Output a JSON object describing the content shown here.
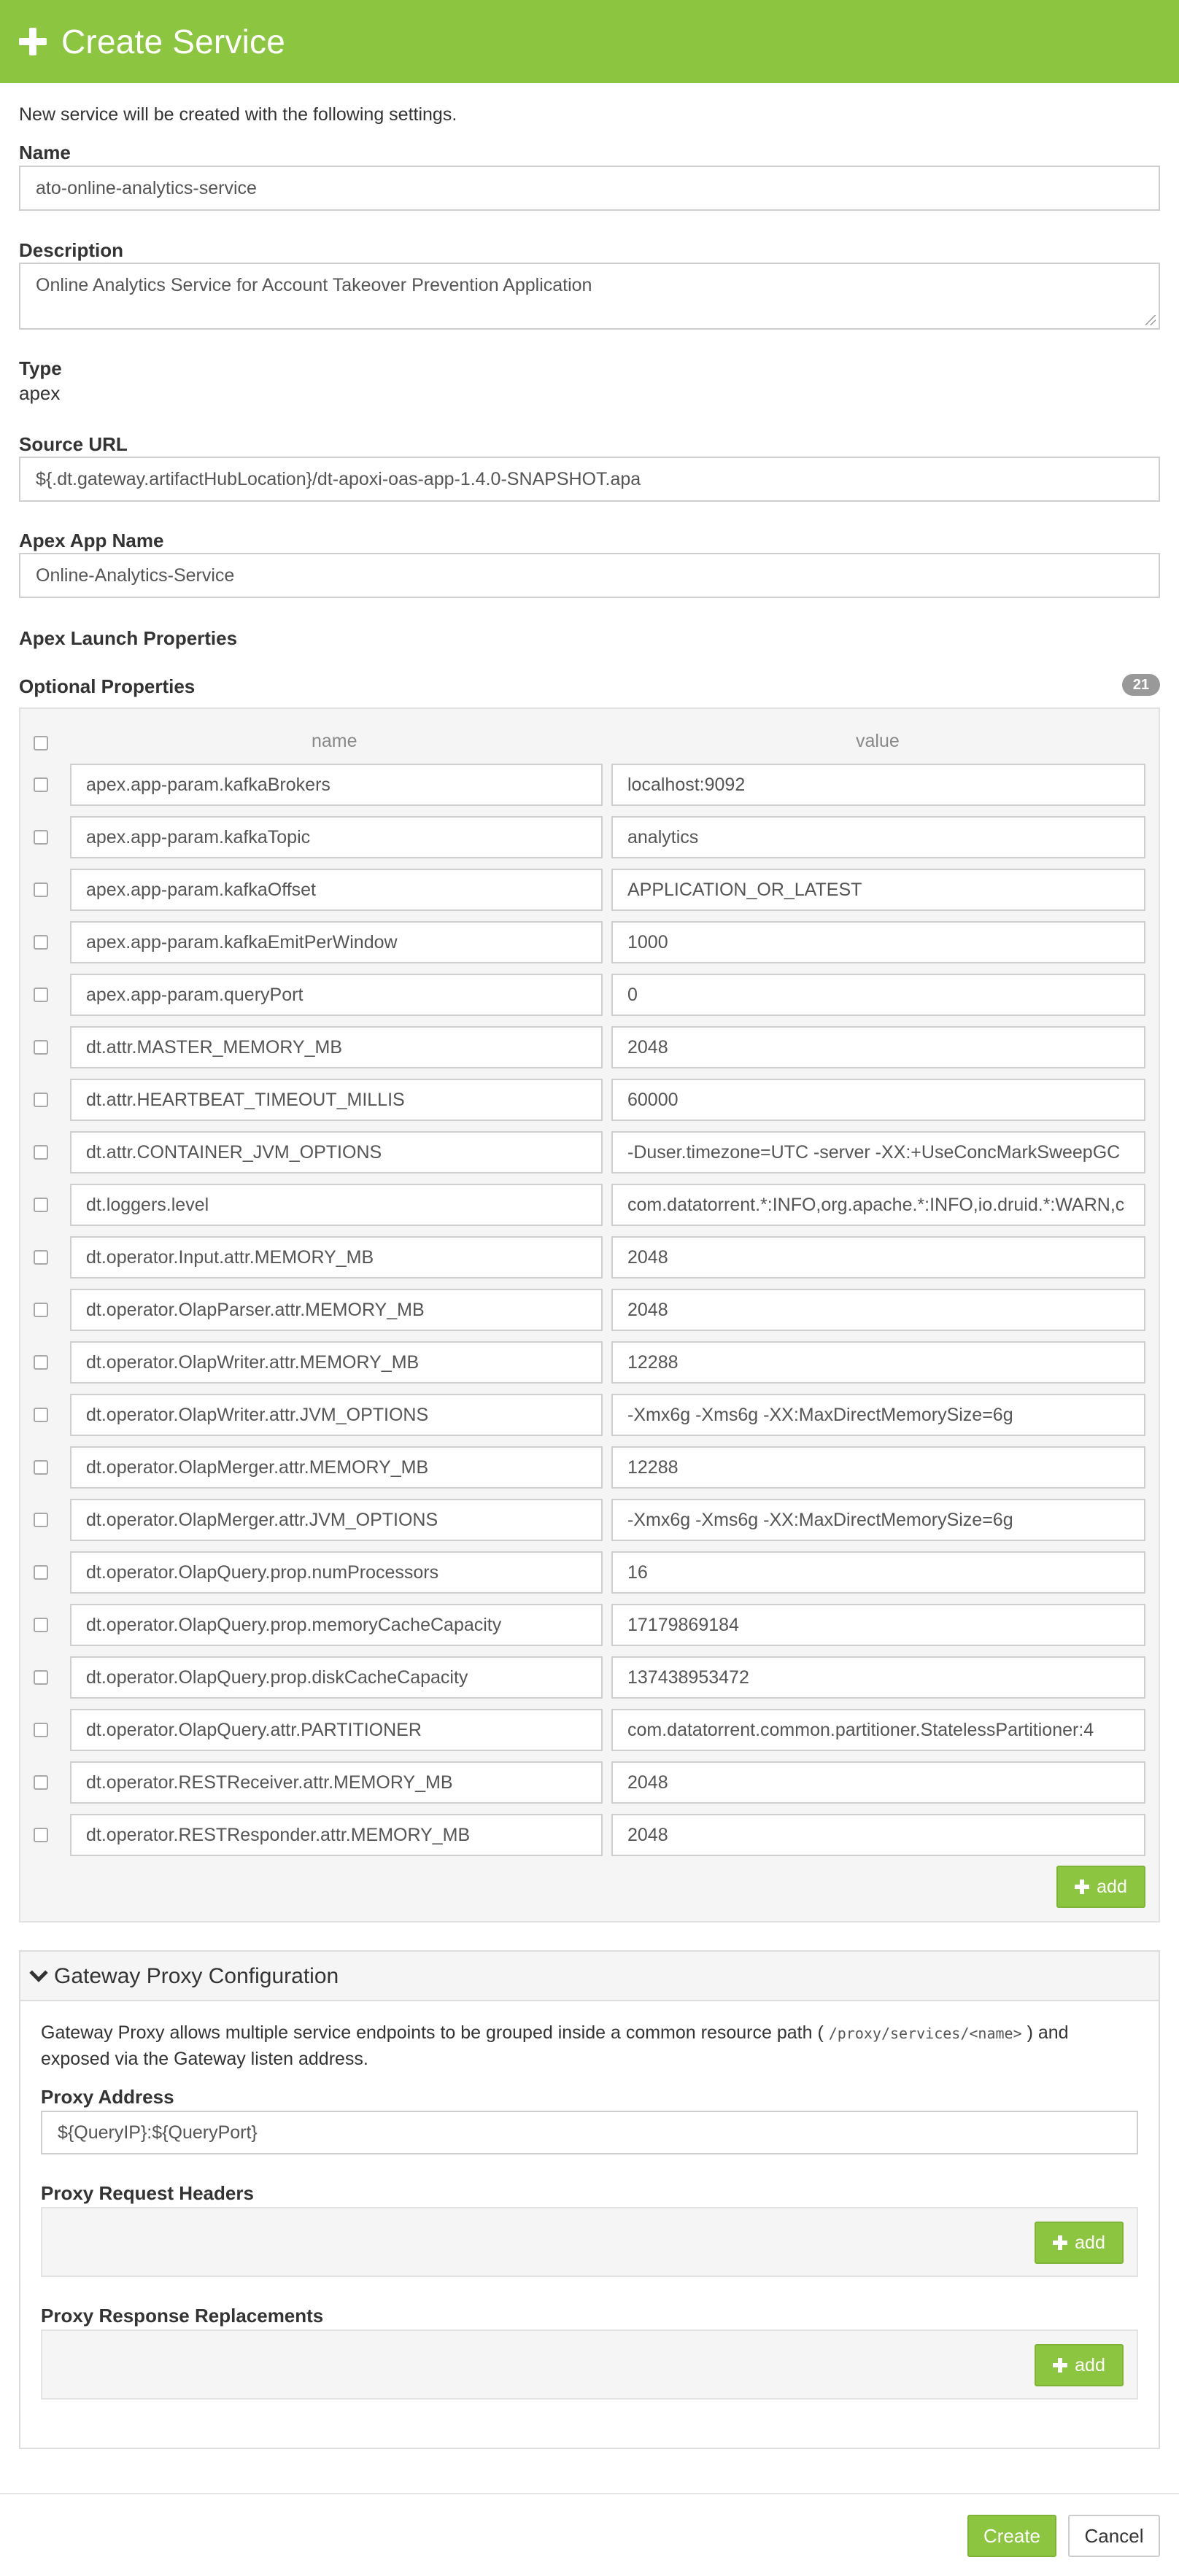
{
  "header": {
    "title": "Create Service"
  },
  "intro": "New service will be created with the following settings.",
  "name": {
    "label": "Name",
    "value": "ato-online-analytics-service"
  },
  "description": {
    "label": "Description",
    "value": "Online Analytics Service for Account Takeover Prevention Application"
  },
  "type": {
    "label": "Type",
    "value": "apex"
  },
  "source_url": {
    "label": "Source URL",
    "value": "${.dt.gateway.artifactHubLocation}/dt-apoxi-oas-app-1.4.0-SNAPSHOT.apa"
  },
  "apex_app_name": {
    "label": "Apex App Name",
    "value": "Online-Analytics-Service"
  },
  "launch_properties": {
    "label": "Apex Launch Properties"
  },
  "optional_properties": {
    "label": "Optional Properties",
    "count": "21",
    "col_name": "name",
    "col_value": "value",
    "add_label": "add",
    "rows": [
      {
        "name": "apex.app-param.kafkaBrokers",
        "value": "localhost:9092"
      },
      {
        "name": "apex.app-param.kafkaTopic",
        "value": "analytics"
      },
      {
        "name": "apex.app-param.kafkaOffset",
        "value": "APPLICATION_OR_LATEST"
      },
      {
        "name": "apex.app-param.kafkaEmitPerWindow",
        "value": "1000"
      },
      {
        "name": "apex.app-param.queryPort",
        "value": "0"
      },
      {
        "name": "dt.attr.MASTER_MEMORY_MB",
        "value": "2048"
      },
      {
        "name": "dt.attr.HEARTBEAT_TIMEOUT_MILLIS",
        "value": "60000"
      },
      {
        "name": "dt.attr.CONTAINER_JVM_OPTIONS",
        "value": "-Duser.timezone=UTC -server -XX:+UseConcMarkSweepGC"
      },
      {
        "name": "dt.loggers.level",
        "value": "com.datatorrent.*:INFO,org.apache.*:INFO,io.druid.*:WARN,c"
      },
      {
        "name": "dt.operator.Input.attr.MEMORY_MB",
        "value": "2048"
      },
      {
        "name": "dt.operator.OlapParser.attr.MEMORY_MB",
        "value": "2048"
      },
      {
        "name": "dt.operator.OlapWriter.attr.MEMORY_MB",
        "value": "12288"
      },
      {
        "name": "dt.operator.OlapWriter.attr.JVM_OPTIONS",
        "value": "-Xmx6g -Xms6g -XX:MaxDirectMemorySize=6g"
      },
      {
        "name": "dt.operator.OlapMerger.attr.MEMORY_MB",
        "value": "12288"
      },
      {
        "name": "dt.operator.OlapMerger.attr.JVM_OPTIONS",
        "value": "-Xmx6g -Xms6g -XX:MaxDirectMemorySize=6g"
      },
      {
        "name": "dt.operator.OlapQuery.prop.numProcessors",
        "value": "16"
      },
      {
        "name": "dt.operator.OlapQuery.prop.memoryCacheCapacity",
        "value": "17179869184"
      },
      {
        "name": "dt.operator.OlapQuery.prop.diskCacheCapacity",
        "value": "137438953472"
      },
      {
        "name": "dt.operator.OlapQuery.attr.PARTITIONER",
        "value": "com.datatorrent.common.partitioner.StatelessPartitioner:4"
      },
      {
        "name": "dt.operator.RESTReceiver.attr.MEMORY_MB",
        "value": "2048"
      },
      {
        "name": "dt.operator.RESTResponder.attr.MEMORY_MB",
        "value": "2048"
      }
    ]
  },
  "gateway": {
    "title": "Gateway Proxy Configuration",
    "desc_before": "Gateway Proxy allows multiple service endpoints to be grouped inside a common resource path ( ",
    "desc_code": "/proxy/services/<name>",
    "desc_after": " ) and exposed via the Gateway listen address.",
    "proxy_address": {
      "label": "Proxy Address",
      "value": "${QueryIP}:${QueryPort}"
    },
    "request_headers": {
      "label": "Proxy Request Headers",
      "add_label": "add"
    },
    "response_replacements": {
      "label": "Proxy Response Replacements",
      "add_label": "add"
    }
  },
  "footer": {
    "create_label": "Create",
    "cancel_label": "Cancel"
  },
  "colors": {
    "accent": "#8cc540",
    "badge": "#999999"
  }
}
